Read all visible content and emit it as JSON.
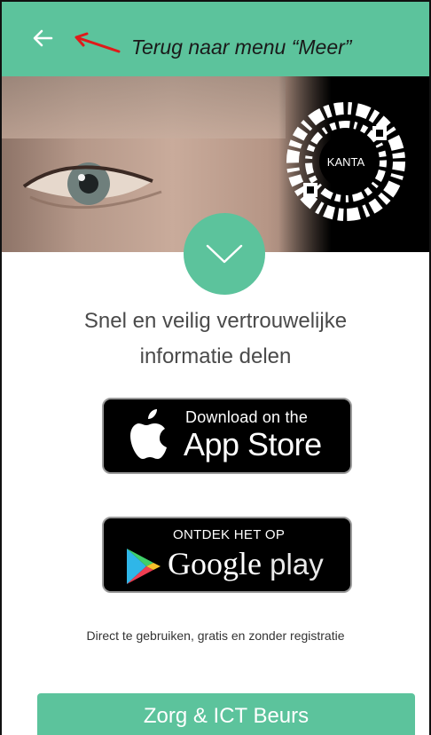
{
  "header": {
    "back_icon": "arrow-left-icon",
    "annotation": "Terug naar menu “Meer”",
    "accent": "#5cc39c",
    "annotation_color": "#e01a1a"
  },
  "hero": {
    "logo_label": "KANTA"
  },
  "main": {
    "chevron_icon": "chevron-down-icon",
    "tagline_line1": "Snel en veilig vertrouwelijke",
    "tagline_line2": "informatie delen",
    "appstore": {
      "small": "Download on the",
      "big": "App Store"
    },
    "googleplay": {
      "small": "ONTDEK HET OP",
      "big_brand": "Google",
      "big_suffix": " play"
    },
    "note": "Direct te gebruiken, gratis en zonder registratie"
  },
  "event": {
    "title": "Zorg & ICT Beurs"
  }
}
